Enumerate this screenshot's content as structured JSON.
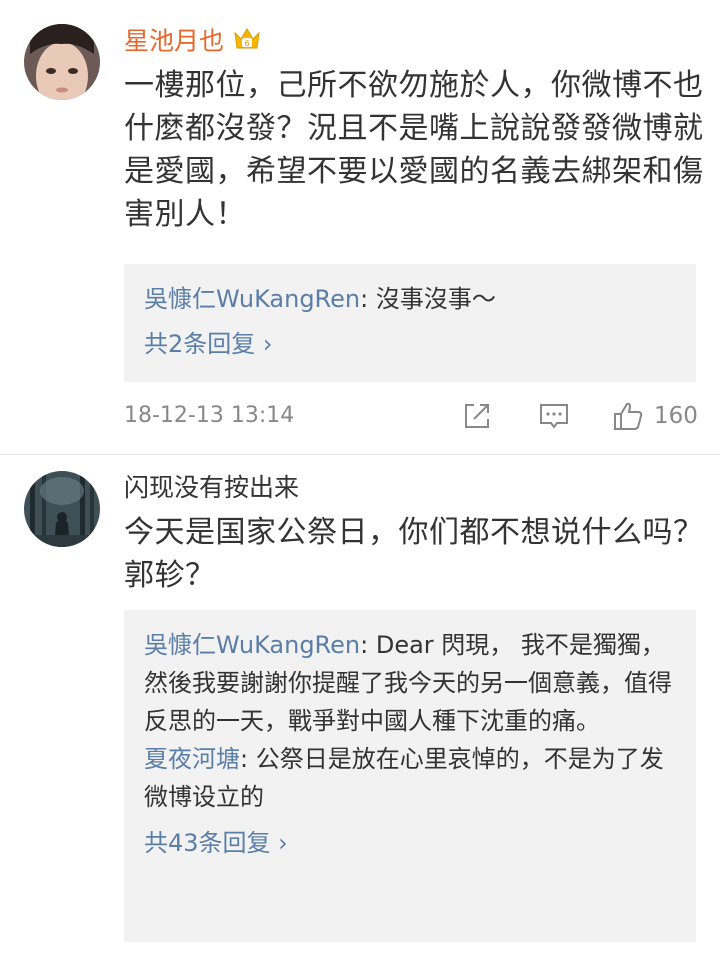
{
  "comments": [
    {
      "username": "星池月也",
      "username_color": "#e8672a",
      "badge_icon": "crown-badge-icon",
      "text": "一樓那位，己所不欲勿施於人，你微博不也什麼都沒發？況且不是嘴上說說發發微博就是愛國，希望不要以愛國的名義去綁架和傷害別人！",
      "replies": [
        {
          "name": "吳慷仁WuKangRen",
          "text": ": 沒事沒事～"
        }
      ],
      "more": "共2条回复 ›",
      "timestamp": "18-12-13 13:14",
      "like_count": "160"
    },
    {
      "username": "闪现没有按出来",
      "username_color": "#333333",
      "text": "今天是国家公祭日，你们都不想说什么吗？郭轸？",
      "replies": [
        {
          "name": "吳慷仁WuKangRen",
          "text": ": Dear 閃現， 我不是獨獨，然後我要謝謝你提醒了我今天的另一個意義，值得反思的一天，戰爭對中國人種下沈重的痛。"
        },
        {
          "name": "夏夜河塘",
          "text": ": 公祭日是放在心里哀悼的，不是为了发微博设立的"
        }
      ],
      "more": "共43条回复 ›"
    }
  ],
  "icons": {
    "share": "share-icon",
    "comment": "comment-icon",
    "like": "thumbs-up-icon"
  },
  "colors": {
    "link": "#5b7ea6",
    "reply_bg": "#f2f2f2",
    "meta": "#888888"
  }
}
